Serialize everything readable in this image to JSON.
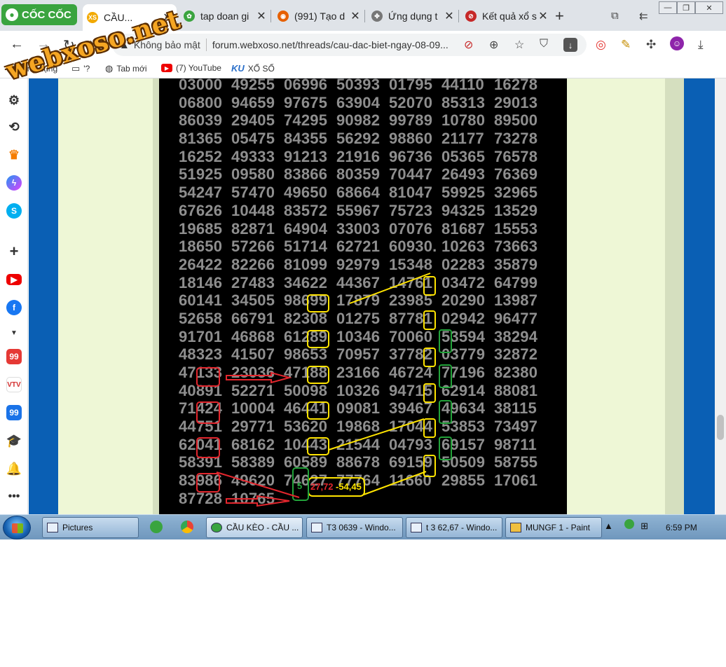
{
  "browser": {
    "brand": "CỐC CỐC",
    "tabs": [
      {
        "title": "CẦU...",
        "icon": "xoso-icon",
        "active": true
      },
      {
        "title": "tap doan gi",
        "icon": "coccoc-icon",
        "active": false
      },
      {
        "title": "(991) Tạo d",
        "icon": "firefox-icon",
        "active": false
      },
      {
        "title": "Ứng dụng t",
        "icon": "puzzle-icon",
        "active": false
      },
      {
        "title": "Kết quả xổ s",
        "icon": "results-icon",
        "active": false
      }
    ],
    "new_tab_label": "+"
  },
  "address_bar": {
    "security_label": "Không bảo mật",
    "url": "forum.webxoso.net/threads/cau-dac-biet-ngay-08-09..."
  },
  "bookmarks": [
    {
      "label": "Ứng dụng",
      "icon": "apps-icon"
    },
    {
      "label": "'?",
      "icon": "folder-icon"
    },
    {
      "label": "Tab mới",
      "icon": "globe-icon"
    },
    {
      "label": "(7) YouTube",
      "icon": "youtube-icon"
    },
    {
      "label": "XỔ SỐ",
      "icon": "ku-icon"
    }
  ],
  "bookmark_ku_prefix": "KU",
  "watermark": "webxoso.net",
  "board": {
    "rows": [
      [
        "03000",
        "49255",
        "06996",
        "50393",
        "01795",
        "44110",
        "16278"
      ],
      [
        "06800",
        "94659",
        "97675",
        "63904",
        "52070",
        "85313",
        "29013"
      ],
      [
        "86039",
        "29405",
        "74295",
        "90982",
        "99789",
        "10780",
        "89500"
      ],
      [
        "81365",
        "05475",
        "84355",
        "56292",
        "98860",
        "21177",
        "73278"
      ],
      [
        "16252",
        "49333",
        "91213",
        "21916",
        "96736",
        "05365",
        "76578"
      ],
      [
        "51925",
        "09580",
        "83866",
        "80359",
        "70447",
        "26493",
        "76369"
      ],
      [
        "54247",
        "57470",
        "49650",
        "68664",
        "81047",
        "59925",
        "32965"
      ],
      [
        "67626",
        "10448",
        "83572",
        "55967",
        "75723",
        "94325",
        "13529"
      ],
      [
        "19685",
        "82871",
        "64904",
        "33003",
        "07076",
        "81687",
        "15553"
      ],
      [
        "18650",
        "57266",
        "51714",
        "62721",
        "60930.",
        "10263",
        "73663"
      ],
      [
        "26422",
        "82266",
        "81099",
        "92979",
        "15348",
        "02283",
        "35879"
      ],
      [
        "18146",
        "27483",
        "34622",
        "44367",
        "14761",
        "03472",
        "64799"
      ],
      [
        "60141",
        "34505",
        "98699",
        "17879",
        "23985",
        "20290",
        "13987"
      ],
      [
        "52658",
        "66791",
        "82308",
        "01275",
        "87781",
        "02942",
        "96477"
      ],
      [
        "91701",
        "46868",
        "61289",
        "10346",
        "70060",
        "53594",
        "38294"
      ],
      [
        "48323",
        "41507",
        "98653",
        "70957",
        "37782",
        "03779",
        "32872"
      ],
      [
        "47133",
        "23036",
        "47188",
        "23166",
        "46724",
        "77196",
        "82380"
      ],
      [
        "40891",
        "52271",
        "50098",
        "10326",
        "94715",
        "62914",
        "88081"
      ],
      [
        "71424",
        "10004",
        "46441",
        "09081",
        "39467",
        "49634",
        "38115"
      ],
      [
        "44751",
        "29771",
        "53620",
        "19868",
        "17044",
        "53853",
        "73497"
      ],
      [
        "62041",
        "68162",
        "10443",
        "21544",
        "04793",
        "69157",
        "98711"
      ],
      [
        "58391",
        "58389",
        "60589",
        "88678",
        "69159",
        "50509",
        "58755"
      ],
      [
        "83986",
        "49620",
        "74627",
        "77764",
        "11660",
        "29855",
        "17061"
      ],
      [
        "87728",
        "10765",
        "",
        "",
        "",
        "",
        ""
      ]
    ],
    "annotation_digit": "5",
    "annotation_red": "27,72",
    "annotation_yellow": "-54,45"
  },
  "colors": {
    "annotation_yellow": "#ffe400",
    "annotation_red": "#e3262d",
    "annotation_green": "#22a33a",
    "board_background": "#000000",
    "page_blue": "#0a5fb4"
  },
  "taskbar": {
    "tasks": [
      {
        "label": "Pictures",
        "icon": "pictures-icon"
      },
      {
        "label": "CẦU KÈO - CẦU ...",
        "icon": "coccoc-icon"
      },
      {
        "label": "T3 0639 - Windo...",
        "icon": "photo-viewer-icon"
      },
      {
        "label": "t 3 62,67 - Windo...",
        "icon": "photo-viewer-icon"
      },
      {
        "label": "MUNGF 1 - Paint",
        "icon": "paint-icon"
      }
    ],
    "clock": "6:59 PM"
  }
}
